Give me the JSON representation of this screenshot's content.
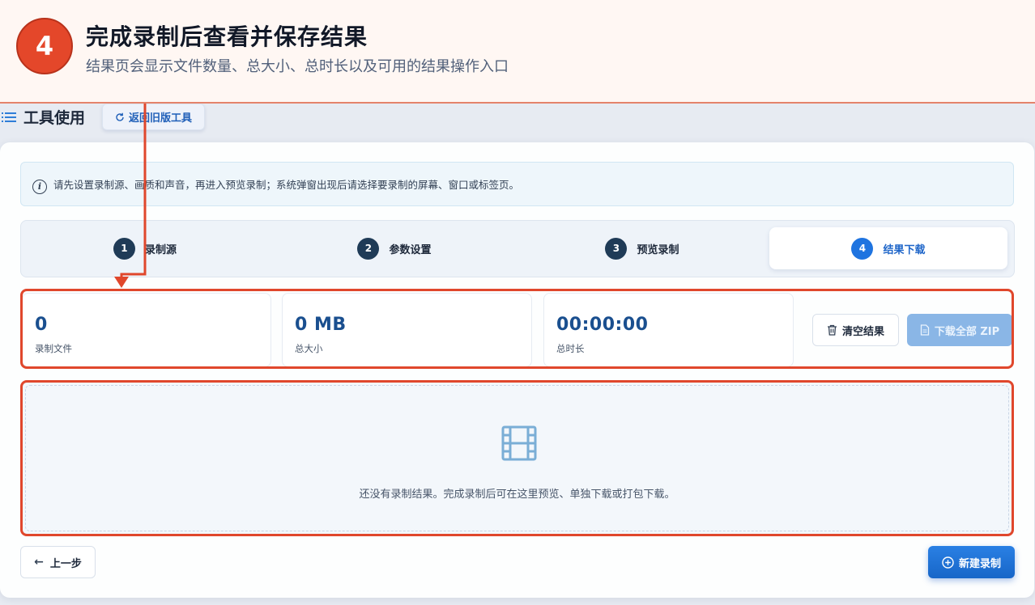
{
  "annotation": {
    "step_number": "4",
    "title": "完成录制后查看并保存结果",
    "subtitle": "结果页会显示文件数量、总大小、总时长以及可用的结果操作入口",
    "accent_color": "#e4472a"
  },
  "header": {
    "title": "工具使用",
    "old_tool_button": "返回旧版工具"
  },
  "info": {
    "text": "请先设置录制源、画质和声音，再进入预览录制；系统弹窗出现后请选择要录制的屏幕、窗口或标签页。"
  },
  "steps": [
    {
      "num": "1",
      "label": "录制源"
    },
    {
      "num": "2",
      "label": "参数设置"
    },
    {
      "num": "3",
      "label": "预览录制"
    },
    {
      "num": "4",
      "label": "结果下载",
      "active": true
    }
  ],
  "stats": [
    {
      "value": "0",
      "label": "录制文件"
    },
    {
      "value": "0 MB",
      "label": "总大小"
    },
    {
      "value": "00:00:00",
      "label": "总时长"
    }
  ],
  "actions": {
    "clear_label": "清空结果",
    "zip_label": "下载全部 ZIP"
  },
  "empty": {
    "text": "还没有录制结果。完成录制后可在这里预览、单独下载或打包下载。"
  },
  "footer": {
    "back_label": "上一步",
    "new_label": "新建录制"
  },
  "colors": {
    "primary": "#1f74e0",
    "highlight_border": "#e0472c",
    "stat_value": "#1a4f8f"
  }
}
